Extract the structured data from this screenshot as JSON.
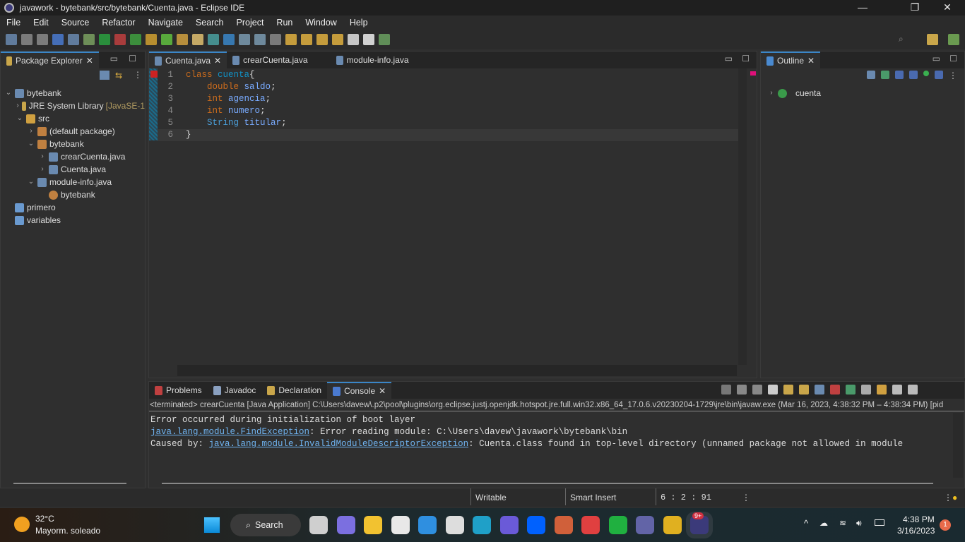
{
  "window": {
    "title": "javawork - bytebank/src/bytebank/Cuenta.java - Eclipse IDE",
    "minimize": "—",
    "restore": "❐",
    "close": "✕"
  },
  "menu": [
    "File",
    "Edit",
    "Source",
    "Refactor",
    "Navigate",
    "Search",
    "Project",
    "Run",
    "Window",
    "Help"
  ],
  "package_explorer": {
    "title": "Package Explorer",
    "tree": [
      {
        "label": "bytebank",
        "indent": 0,
        "chev": "v",
        "icon": "project-error-icon"
      },
      {
        "label": "JRE System Library",
        "suffix": "[JavaSE-1",
        "indent": 1,
        "chev": ">",
        "icon": "library-icon"
      },
      {
        "label": "src",
        "indent": 1,
        "chev": "v",
        "icon": "source-folder-error-icon"
      },
      {
        "label": "(default package)",
        "indent": 2,
        "chev": ">",
        "icon": "package-error-icon"
      },
      {
        "label": "bytebank",
        "indent": 2,
        "chev": "v",
        "icon": "package-error-icon"
      },
      {
        "label": "crearCuenta.java",
        "indent": 3,
        "chev": ">",
        "icon": "java-file-error-icon"
      },
      {
        "label": "Cuenta.java",
        "indent": 3,
        "chev": ">",
        "icon": "java-file-error-icon"
      },
      {
        "label": "module-info.java",
        "indent": 2,
        "chev": "v",
        "icon": "java-file-icon"
      },
      {
        "label": "bytebank",
        "indent": 3,
        "chev": "",
        "icon": "module-icon"
      },
      {
        "label": "primero",
        "indent": 0,
        "chev": "",
        "icon": "folder-icon"
      },
      {
        "label": "variables",
        "indent": 0,
        "chev": "",
        "icon": "folder-icon"
      }
    ]
  },
  "editor": {
    "tabs": [
      {
        "label": "Cuenta.java",
        "active": true
      },
      {
        "label": "crearCuenta.java"
      },
      {
        "label": "module-info.java"
      }
    ],
    "lines": [
      {
        "n": "1",
        "parts": [
          [
            "kw",
            "class"
          ],
          [
            "",
            " "
          ],
          [
            "cls",
            "cuenta"
          ],
          [
            "",
            "{"
          ]
        ]
      },
      {
        "n": "2",
        "parts": [
          [
            "",
            "    "
          ],
          [
            "kw",
            "double"
          ],
          [
            "",
            " "
          ],
          [
            "id",
            "saldo"
          ],
          [
            "",
            ";"
          ]
        ]
      },
      {
        "n": "3",
        "parts": [
          [
            "",
            "    "
          ],
          [
            "kw",
            "int"
          ],
          [
            "",
            " "
          ],
          [
            "id",
            "agencia"
          ],
          [
            "",
            ";"
          ]
        ]
      },
      {
        "n": "4",
        "parts": [
          [
            "",
            "    "
          ],
          [
            "kw",
            "int"
          ],
          [
            "",
            " "
          ],
          [
            "id",
            "numero"
          ],
          [
            "",
            ";"
          ]
        ]
      },
      {
        "n": "5",
        "parts": [
          [
            "",
            "    "
          ],
          [
            "ty",
            "String"
          ],
          [
            "",
            " "
          ],
          [
            "id",
            "titular"
          ],
          [
            "",
            ";"
          ]
        ]
      },
      {
        "n": "6",
        "parts": [
          [
            "",
            "}"
          ]
        ]
      }
    ]
  },
  "outline": {
    "title": "Outline",
    "items": [
      {
        "label": "cuenta"
      }
    ]
  },
  "bottom": {
    "tabs": [
      {
        "label": "Problems"
      },
      {
        "label": "Javadoc"
      },
      {
        "label": "Declaration"
      },
      {
        "label": "Console",
        "active": true
      }
    ],
    "terminated": "<terminated> crearCuenta [Java Application] C:\\Users\\davew\\.p2\\pool\\plugins\\org.eclipse.justj.openjdk.hotspot.jre.full.win32.x86_64_17.0.6.v20230204-1729\\jre\\bin\\javaw.exe  (Mar 16, 2023, 4:38:32 PM – 4:38:34 PM) [pid",
    "line1": "Error occurred during initialization of boot layer",
    "line2_link": "java.lang.module.FindException",
    "line2_rest": ": Error reading module: C:\\Users\\davew\\javawork\\bytebank\\bin",
    "line3_pre": "Caused by: ",
    "line3_link": "java.lang.module.InvalidModuleDescriptorException",
    "line3_rest": ": Cuenta.class found in top-level directory (unnamed package not allowed in module"
  },
  "status": {
    "writable": "Writable",
    "insert": "Smart Insert",
    "position": "6 : 2 : 91"
  },
  "taskbar": {
    "weather_temp": "32°C",
    "weather_desc": "Mayorm. soleado",
    "search": "Search",
    "time": "4:38 PM",
    "date": "3/16/2023",
    "teams_badge": "9+",
    "notif_count": "1",
    "apps": [
      {
        "name": "task-view",
        "color": "#cfcfcf"
      },
      {
        "name": "meet",
        "color": "#7b6fe0"
      },
      {
        "name": "file-explorer",
        "color": "#f2c230"
      },
      {
        "name": "store",
        "color": "#e8e8e8"
      },
      {
        "name": "mail",
        "color": "#2f8fe0"
      },
      {
        "name": "app-s",
        "color": "#dddddd"
      },
      {
        "name": "edge",
        "color": "#1fa0c8"
      },
      {
        "name": "copilot",
        "color": "#6a5ad8"
      },
      {
        "name": "dropbox",
        "color": "#0061fe"
      },
      {
        "name": "media-player",
        "color": "#d0603a"
      },
      {
        "name": "browser-o",
        "color": "#e04040"
      },
      {
        "name": "app-ring",
        "color": "#20b040"
      },
      {
        "name": "teams",
        "color": "#6264a7"
      },
      {
        "name": "chrome",
        "color": "#e0b020"
      },
      {
        "name": "eclipse",
        "color": "#3b3a7a"
      }
    ]
  }
}
